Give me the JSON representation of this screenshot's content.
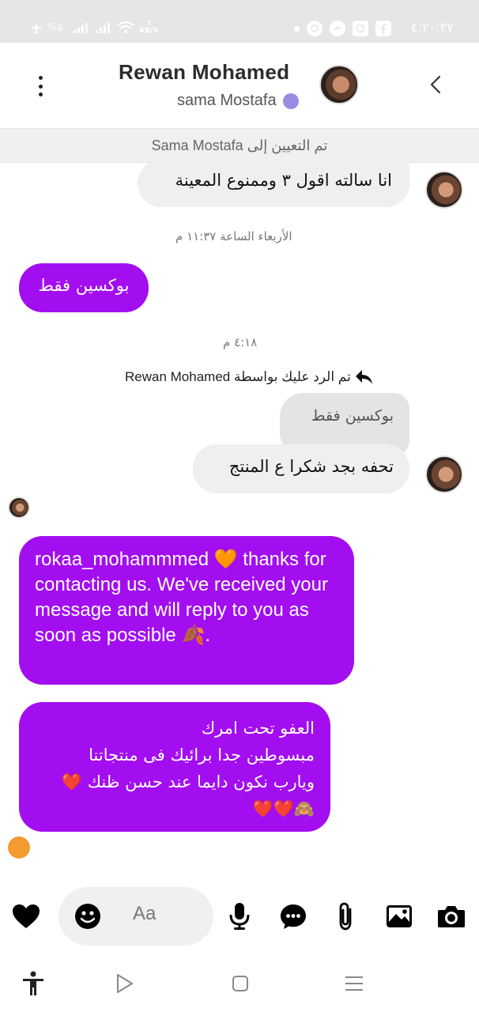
{
  "status_bar": {
    "time": "٤:٢٠:٣٧",
    "left_text": "%٥٠",
    "speed_value": "٦",
    "speed_unit": "KB/S"
  },
  "header": {
    "contact_name": "Rewan Mohamed",
    "assigned_to": "sama Mostafa",
    "status_color": "#9b8be3"
  },
  "assignment_banner": "تم التعيين إلى Sama Mostafa",
  "messages": {
    "m1_text": "انا سالته اقول ٣ وممنوع المعينة",
    "ts1": "الأربعاء الساعة ١١:٣٧ م",
    "m2_text": "بوكسين فقط",
    "ts2": "٤:١٨ م",
    "reply_note": "تم الرد عليك بواسطة Rewan Mohamed",
    "quote_text": "بوكسين فقط",
    "m3_text": "تحفه بجد شكرا ع المنتج",
    "m4_text": "rokaa_mohammmed 🧡 thanks for contacting us. We've received your message and will reply to you as soon as possible 🍂.",
    "m5_line1": "العفو تحت امرك",
    "m5_line2": "مبسوطين جدا برائيك فى منتجاتنا",
    "m5_line3": "ويارب نكون دايما عند حسن ظنك ❤️",
    "m5_line4": "🙈❤️❤️"
  },
  "composer": {
    "placeholder": "Aa"
  },
  "colors": {
    "outgoing_bubble": "#a30ef0",
    "incoming_bubble": "#efefef"
  },
  "icons": [
    "like-heart-icon",
    "emoji-icon",
    "microphone-icon",
    "saved-replies-icon",
    "attachment-icon",
    "image-icon",
    "camera-icon"
  ]
}
